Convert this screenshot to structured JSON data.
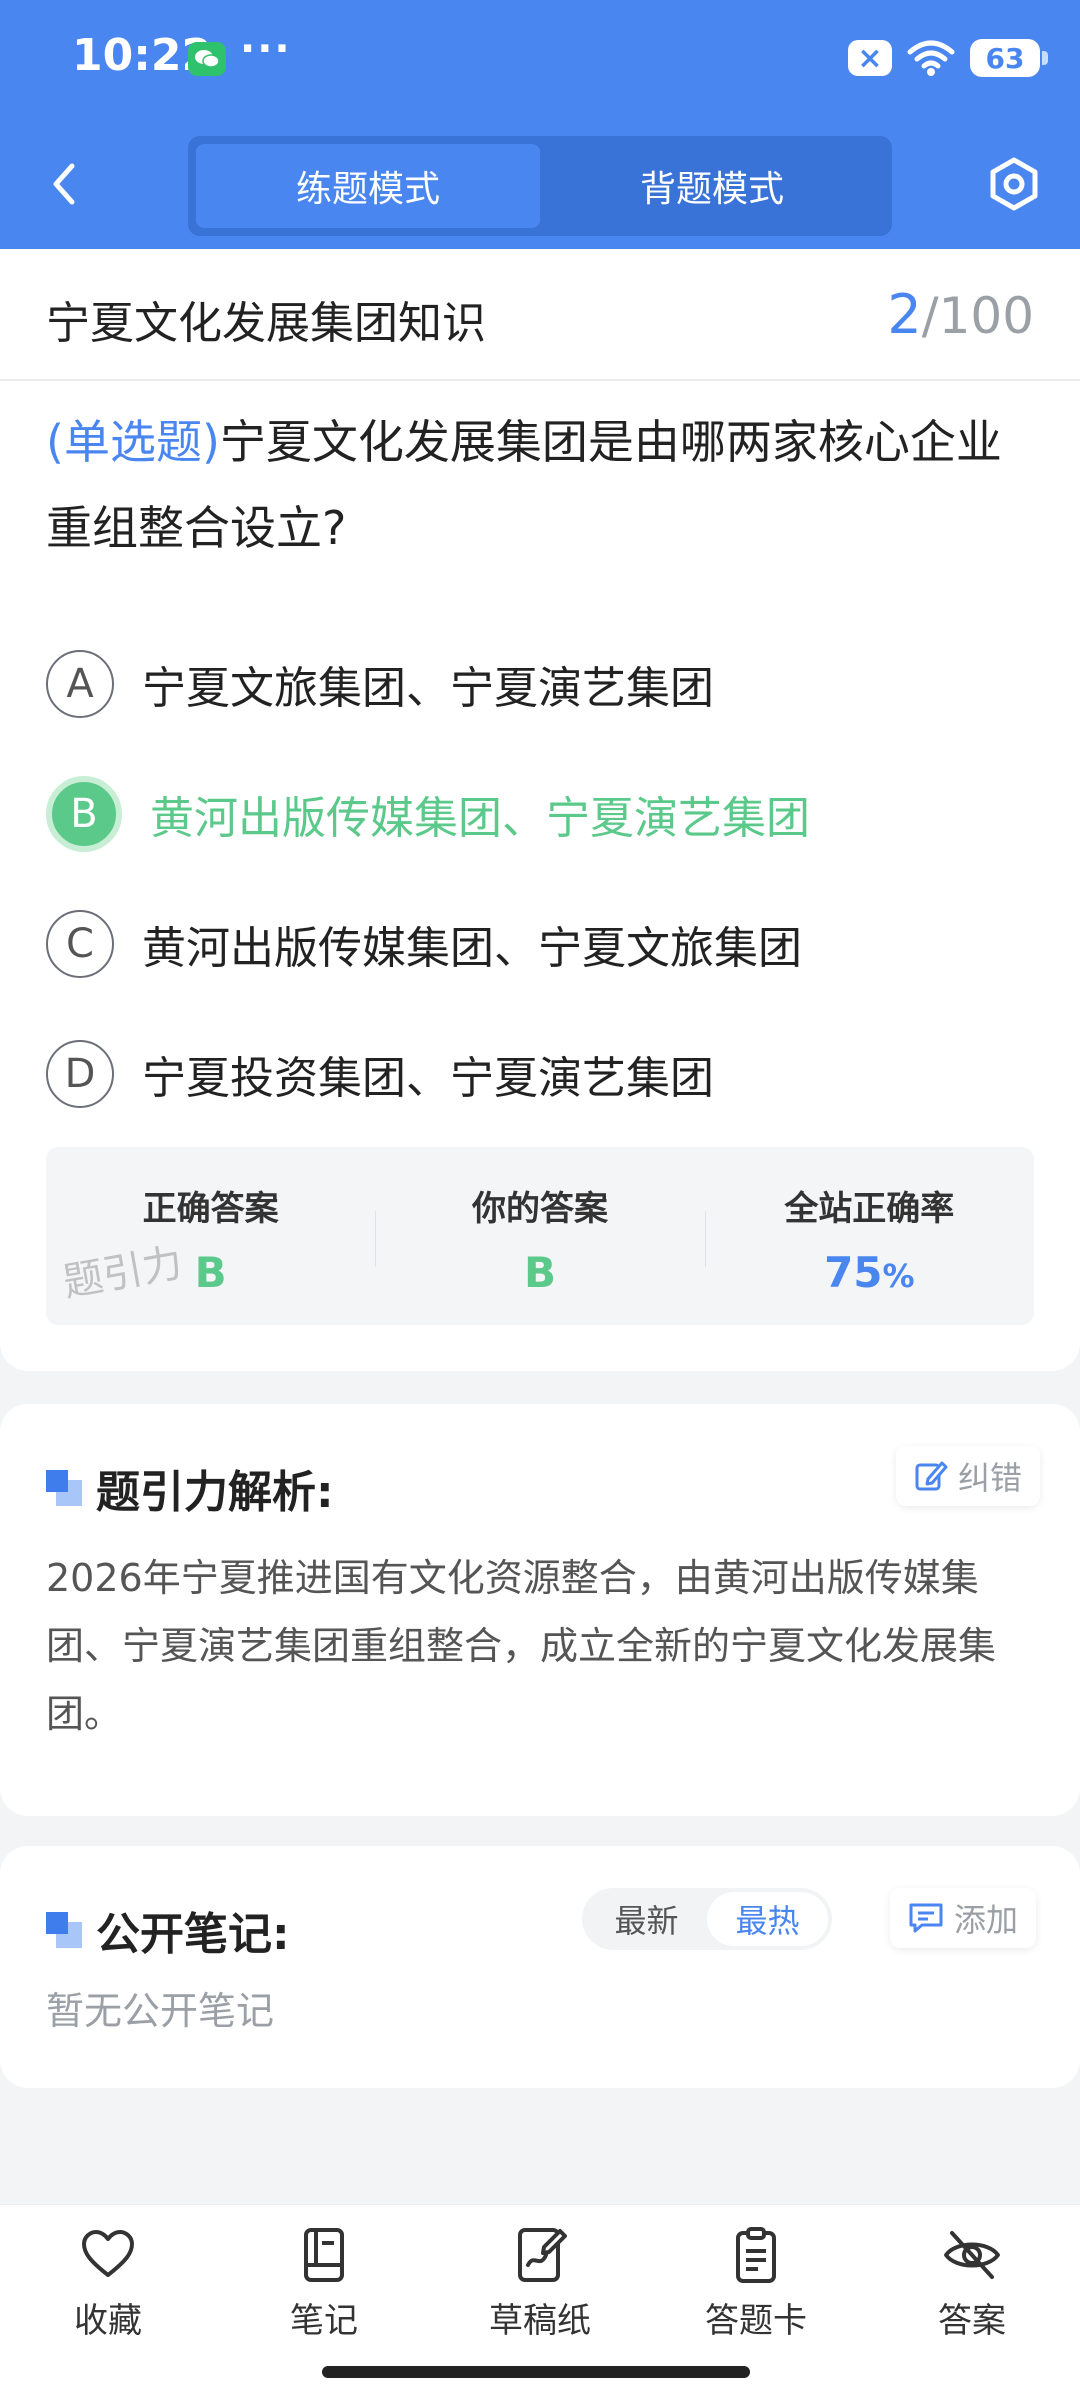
{
  "status_bar": {
    "time": "10:22",
    "dots": "···",
    "battery": "63"
  },
  "nav": {
    "modes": [
      {
        "label": "练题模式",
        "active": true
      },
      {
        "label": "背题模式",
        "active": false
      }
    ]
  },
  "header": {
    "collection_title": "宁夏文化发展集团知识",
    "current": "2",
    "total": "/100"
  },
  "question": {
    "type": "(单选题)",
    "text": "宁夏文化发展集团是由哪两家核心企业重组整合设立?",
    "options": [
      {
        "letter": "A",
        "text": "宁夏文旅集团、宁夏演艺集团"
      },
      {
        "letter": "B",
        "text": "黄河出版传媒集团、宁夏演艺集团",
        "correct": true
      },
      {
        "letter": "C",
        "text": "黄河出版传媒集团、宁夏文旅集团"
      },
      {
        "letter": "D",
        "text": "宁夏投资集团、宁夏演艺集团"
      }
    ]
  },
  "stats": {
    "correct_label": "正确答案",
    "correct_value": "B",
    "yours_label": "你的答案",
    "yours_value": "B",
    "rate_label": "全站正确率",
    "rate_value": "75",
    "rate_unit": "%",
    "watermark": "题引力"
  },
  "analysis": {
    "title": "题引力解析:",
    "report_label": "纠错",
    "text": "2026年宁夏推进国有文化资源整合，由黄河出版传媒集团、宁夏演艺集团重组整合，成立全新的宁夏文化发展集团。"
  },
  "notes": {
    "title": "公开笔记:",
    "sort_options": [
      "最新",
      "最热"
    ],
    "sort_active": "最热",
    "add_label": "添加",
    "empty_text": "暂无公开笔记"
  },
  "bottom_tabs": [
    {
      "label": "收藏",
      "icon": "heart-icon"
    },
    {
      "label": "笔记",
      "icon": "notebook-icon"
    },
    {
      "label": "草稿纸",
      "icon": "draft-paper-icon"
    },
    {
      "label": "答题卡",
      "icon": "answer-sheet-icon"
    },
    {
      "label": "答案",
      "icon": "eye-off-icon"
    }
  ],
  "colors": {
    "brand_blue": "#4a86f0",
    "correct_green": "#5bc98a"
  }
}
